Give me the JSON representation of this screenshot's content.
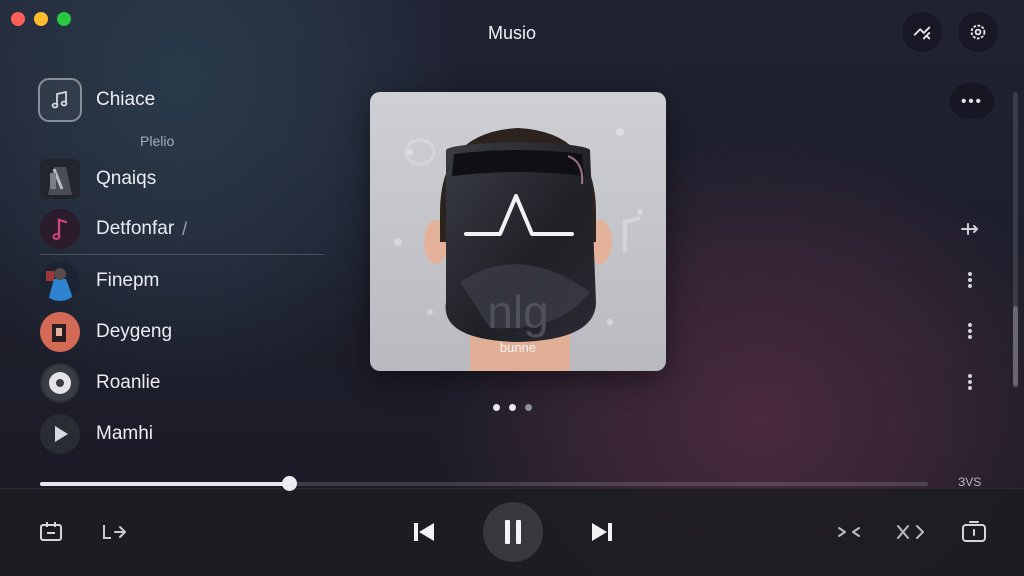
{
  "window": {
    "title": "Musio"
  },
  "library": {
    "title": "Chiace",
    "subtitle": "Plelio"
  },
  "tracks": [
    {
      "name": "Qnaiqs",
      "extra": ""
    },
    {
      "name": "Detfonfar",
      "extra": "/"
    },
    {
      "name": "Finepm",
      "extra": ""
    },
    {
      "name": "Deygeng",
      "extra": ""
    },
    {
      "name": "Roanlie",
      "extra": ""
    },
    {
      "name": "Mamhi",
      "extra": ""
    }
  ],
  "now_playing": {
    "art_caption": "bunne",
    "progress": 0.28,
    "time_label": "ЗVS"
  },
  "colors": {
    "accent_pink": "#d0467f",
    "traffic_red": "#ff5f57",
    "traffic_yellow": "#febc2e",
    "traffic_green": "#28c840"
  }
}
